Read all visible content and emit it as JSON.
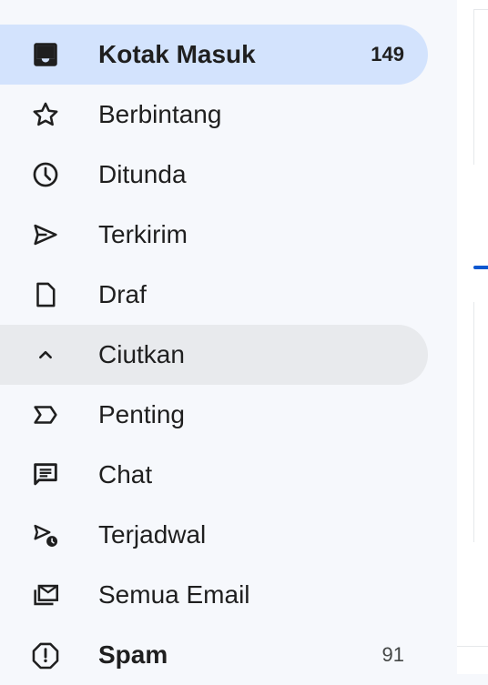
{
  "nav": {
    "items": [
      {
        "label": "Kotak Masuk",
        "count": "149",
        "icon": "inbox-icon"
      },
      {
        "label": "Berbintang",
        "count": "",
        "icon": "star-icon"
      },
      {
        "label": "Ditunda",
        "count": "",
        "icon": "clock-icon"
      },
      {
        "label": "Terkirim",
        "count": "",
        "icon": "send-icon"
      },
      {
        "label": "Draf",
        "count": "",
        "icon": "draft-icon"
      },
      {
        "label": "Ciutkan",
        "count": "",
        "icon": "chevron-up-icon"
      },
      {
        "label": "Penting",
        "count": "",
        "icon": "important-label-icon"
      },
      {
        "label": "Chat",
        "count": "",
        "icon": "chat-icon"
      },
      {
        "label": "Terjadwal",
        "count": "",
        "icon": "scheduled-send-icon"
      },
      {
        "label": "Semua Email",
        "count": "",
        "icon": "all-mail-icon"
      },
      {
        "label": "Spam",
        "count": "91",
        "icon": "spam-icon"
      }
    ]
  },
  "colors": {
    "active_bg": "#d3e3fd",
    "hover_bg": "#e8eaed",
    "sidebar_bg": "#f6f8fc",
    "accent": "#0b57d0"
  }
}
